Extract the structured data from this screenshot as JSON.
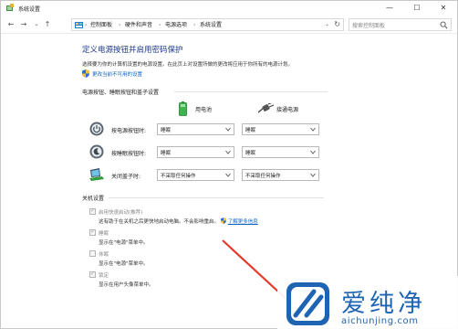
{
  "window": {
    "title": "系统设置",
    "minimize_glyph": "—",
    "maximize_glyph": "☐",
    "close_glyph": "✕"
  },
  "nav": {
    "back_glyph": "←",
    "forward_glyph": "→",
    "recent_glyph": "⌄",
    "up_glyph": "↑",
    "breadcrumb": [
      "控制面板",
      "硬件和声音",
      "电源选项",
      "系统设置"
    ],
    "separator": "›",
    "address_dropdown_glyph": "⌄",
    "refresh_glyph": "↻",
    "search_placeholder": "搜索控制面板"
  },
  "page": {
    "heading": "定义电源按钮并启用密码保护",
    "description": "选择要为你的计算机设置的电源设置。在此页上对设置所做的更改将应用于你所有的电源计划。",
    "change_unavailable_link": "更改当前不可用的设置"
  },
  "buttons_section": {
    "title": "电源按钮、睡眠按钮和盖子设置",
    "columns": [
      "用电池",
      "接通电源"
    ],
    "rows": [
      {
        "icon": "power-button-icon",
        "label": "按电源按钮时:",
        "battery": "睡眠",
        "plugged": "睡眠"
      },
      {
        "icon": "sleep-button-icon",
        "label": "按睡眠按钮时:",
        "battery": "睡眠",
        "plugged": "睡眠"
      },
      {
        "icon": "laptop-lid-icon",
        "label": "关闭盖子时:",
        "battery": "不采取任何操作",
        "plugged": "不采取任何操作"
      }
    ]
  },
  "shutdown_section": {
    "title": "关机设置",
    "items": [
      {
        "label": "启用快速启动(推荐)",
        "checked": true,
        "desc": "这有助于在关机之后更快地启动电脑。不会影响重启。",
        "link": "了解更多信息"
      },
      {
        "label": "睡眠",
        "checked": true,
        "desc": "显示在\"电源\"菜单中。"
      },
      {
        "label": "休眠",
        "checked": false,
        "desc": "显示在\"电源\"菜单中。"
      },
      {
        "label": "锁定",
        "checked": true,
        "desc": "显示在用户头像菜单中。"
      }
    ]
  },
  "watermark": {
    "title": "爱纯净",
    "url": "aichunjing.com"
  },
  "colors": {
    "heading": "#1e3a8c",
    "link": "#0a63c9",
    "arrow": "#e53a2a",
    "watermark": "#1f64b3"
  }
}
